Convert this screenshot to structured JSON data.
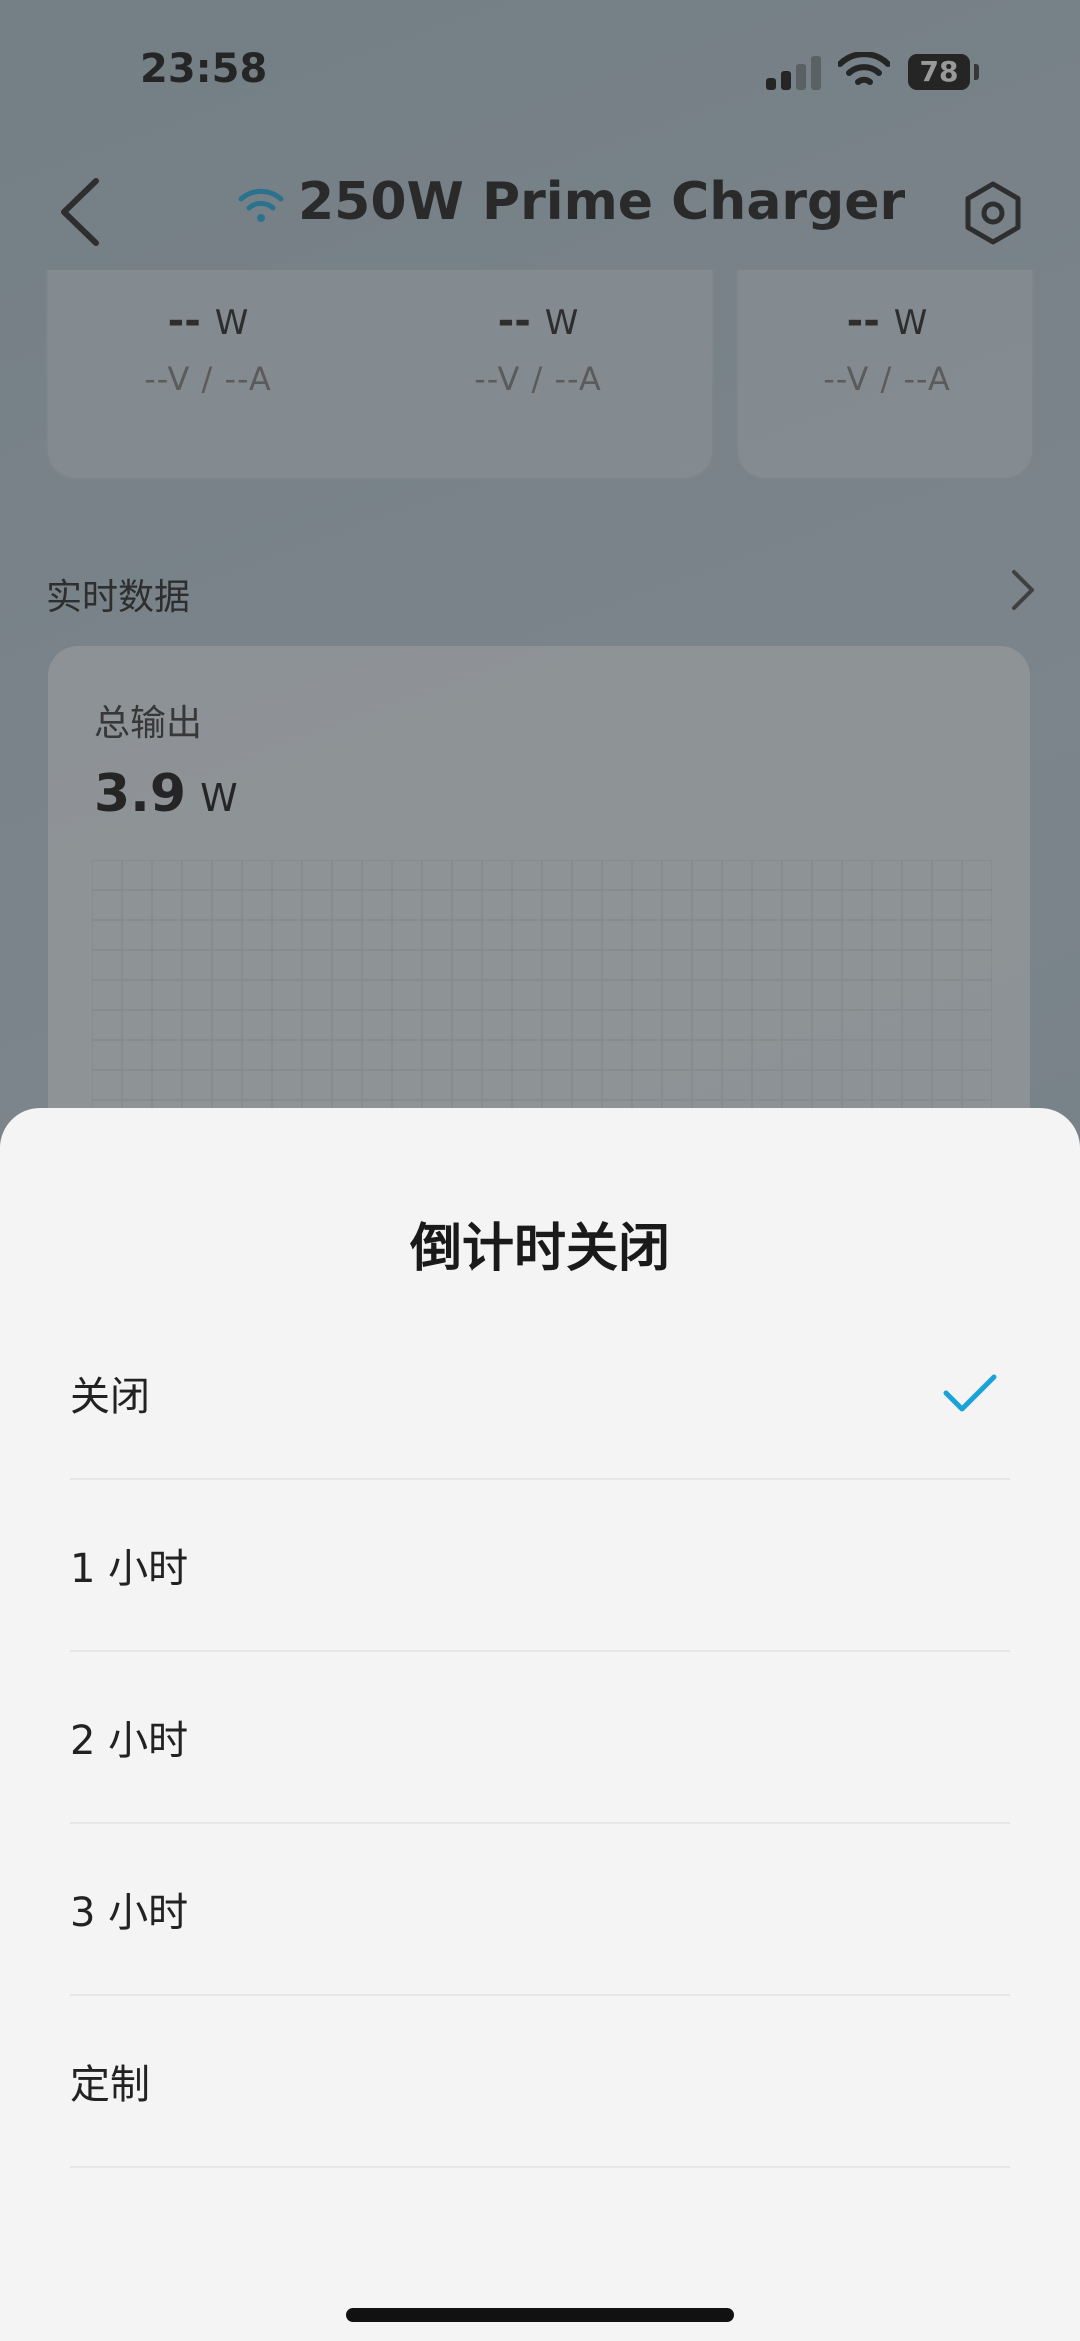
{
  "status_bar": {
    "time": "23:58",
    "battery": "78"
  },
  "header": {
    "title": "250W Prime Charger"
  },
  "ports": [
    {
      "power": "--",
      "unit": "W",
      "va": "--V / --A"
    },
    {
      "power": "--",
      "unit": "W",
      "va": "--V / --A"
    },
    {
      "power": "--",
      "unit": "W",
      "va": "--V / --A"
    }
  ],
  "realtime": {
    "section_label": "实时数据",
    "total_label": "总输出",
    "total_value": "3.9",
    "total_unit": "W"
  },
  "sheet": {
    "title": "倒计时关闭",
    "options": [
      {
        "label": "关闭",
        "selected": true
      },
      {
        "label": "1 小时",
        "selected": false
      },
      {
        "label": "2 小时",
        "selected": false
      },
      {
        "label": "3 小时",
        "selected": false
      },
      {
        "label": "定制",
        "selected": false
      }
    ]
  },
  "colors": {
    "accent": "#1aa3d9",
    "sheet_bg": "#f4f4f4"
  }
}
